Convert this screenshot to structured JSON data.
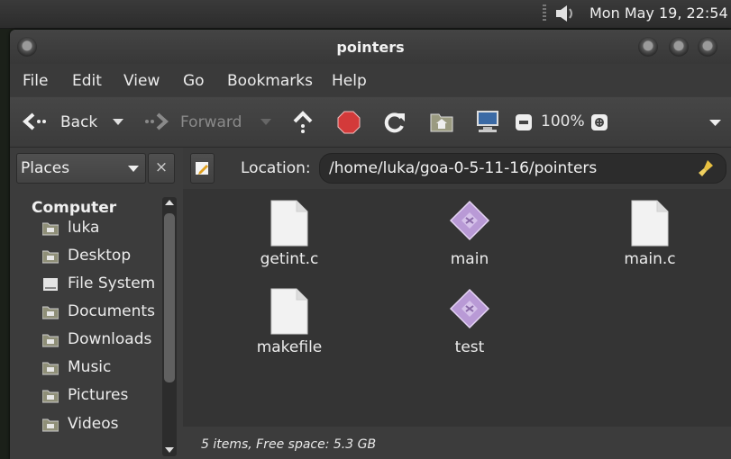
{
  "panel": {
    "clock": "Mon May 19, 22:54"
  },
  "window": {
    "title": "pointers",
    "menu": [
      "File",
      "Edit",
      "View",
      "Go",
      "Bookmarks",
      "Help"
    ]
  },
  "toolbar": {
    "back_label": "Back",
    "forward_label": "Forward",
    "zoom_label": "100%"
  },
  "sidebar": {
    "selector_label": "Places",
    "close_label": "×",
    "section_header": "Computer",
    "items": [
      {
        "label": "luka",
        "icon": "home-folder-icon"
      },
      {
        "label": "Desktop",
        "icon": "desktop-folder-icon"
      },
      {
        "label": "File System",
        "icon": "drive-icon"
      },
      {
        "label": "Documents",
        "icon": "documents-folder-icon"
      },
      {
        "label": "Downloads",
        "icon": "downloads-folder-icon"
      },
      {
        "label": "Music",
        "icon": "music-folder-icon"
      },
      {
        "label": "Pictures",
        "icon": "pictures-folder-icon"
      },
      {
        "label": "Videos",
        "icon": "videos-folder-icon"
      }
    ]
  },
  "location": {
    "label": "Location:",
    "path": "/home/luka/goa-0-5-11-16/pointers"
  },
  "files": [
    {
      "name": "getint.c",
      "type": "text"
    },
    {
      "name": "main",
      "type": "executable"
    },
    {
      "name": "main.c",
      "type": "text"
    },
    {
      "name": "makefile",
      "type": "text"
    },
    {
      "name": "test",
      "type": "executable"
    }
  ],
  "status": {
    "text": "5 items, Free space: 5.3 GB"
  },
  "colors": {
    "background": "#1b2019",
    "window": "#3c3c3c",
    "icon_view": "#343434",
    "stop_red": "#d33a3a",
    "executable_purple": "#b99ad6"
  }
}
